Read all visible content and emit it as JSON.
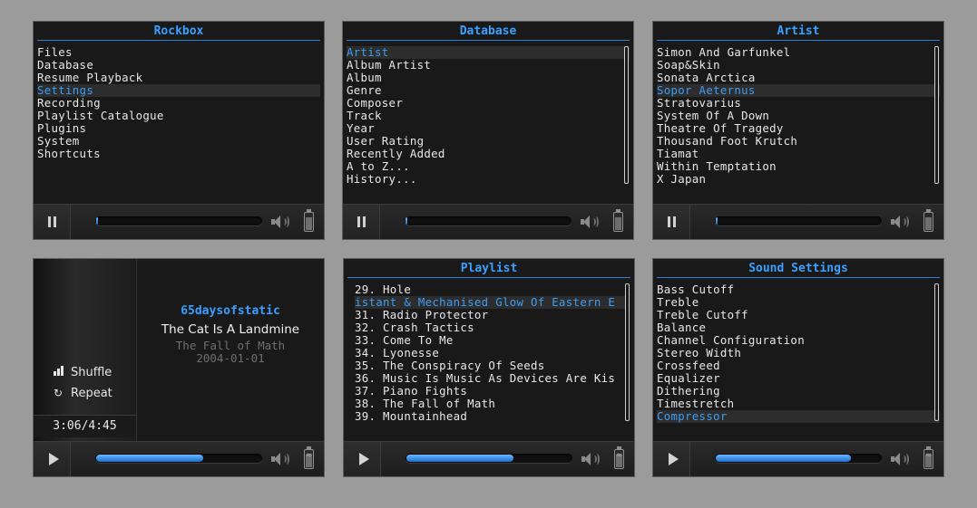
{
  "screens": {
    "rockbox": {
      "title": "Rockbox",
      "items": [
        "Files",
        "Database",
        "Resume Playback",
        "Settings",
        "Recording",
        "Playlist Catalogue",
        "Plugins",
        "System",
        "Shortcuts"
      ],
      "selected_index": 3
    },
    "database": {
      "title": "Database",
      "items": [
        "Artist",
        "Album Artist",
        "Album",
        "Genre",
        "Composer",
        "Track",
        "Year",
        "User Rating",
        "Recently Added",
        "A to Z...",
        "History..."
      ],
      "selected_index": 0
    },
    "artist": {
      "title": "Artist",
      "items": [
        "Simon And Garfunkel",
        "Soap&Skin",
        "Sonata Arctica",
        "Sopor Aeternus",
        "Stratovarius",
        "System Of A Down",
        "Theatre Of Tragedy",
        "Thousand Foot Krutch",
        "Tiamat",
        "Within Temptation",
        "X Japan"
      ],
      "selected_index": 3
    },
    "now_playing": {
      "artist": "65daysofstatic",
      "title": "The Cat Is A Landmine",
      "album": "The Fall of Math",
      "date": "2004-01-01",
      "shuffle_label": "Shuffle",
      "repeat_label": "Repeat",
      "time": "3:06/4:45"
    },
    "playlist": {
      "title": "Playlist",
      "items": [
        "29. Hole",
        "istant & Mechanised Glow Of Eastern E",
        "31. Radio Protector",
        "32. Crash Tactics",
        "33. Come To Me",
        "34. Lyonesse",
        "35. The Conspiracy Of Seeds",
        "36. Music Is Music As Devices Are Kis",
        "37. Piano Fights",
        "38. The Fall of Math",
        "39. Mountainhead"
      ],
      "selected_index": 1
    },
    "sound": {
      "title": "Sound Settings",
      "items": [
        "Bass Cutoff",
        "Treble",
        "Treble Cutoff",
        "Balance",
        "Channel Configuration",
        "Stereo Width",
        "Crossfeed",
        "Equalizer",
        "Dithering",
        "Timestretch",
        "Compressor"
      ],
      "selected_index": 10
    }
  },
  "statusbar": {
    "top_row_state": "paused",
    "bottom_row_state": "playing",
    "progress": {
      "now_playing": 0.65,
      "playlist": 0.65,
      "sound": 0.82,
      "top_rows": 0.01
    },
    "icons": [
      "pause-icon",
      "play-icon",
      "volume-icon",
      "battery-icon"
    ]
  },
  "colors": {
    "accent": "#3aa0ff",
    "background": "#191919",
    "selection": "#2d2d2d"
  }
}
